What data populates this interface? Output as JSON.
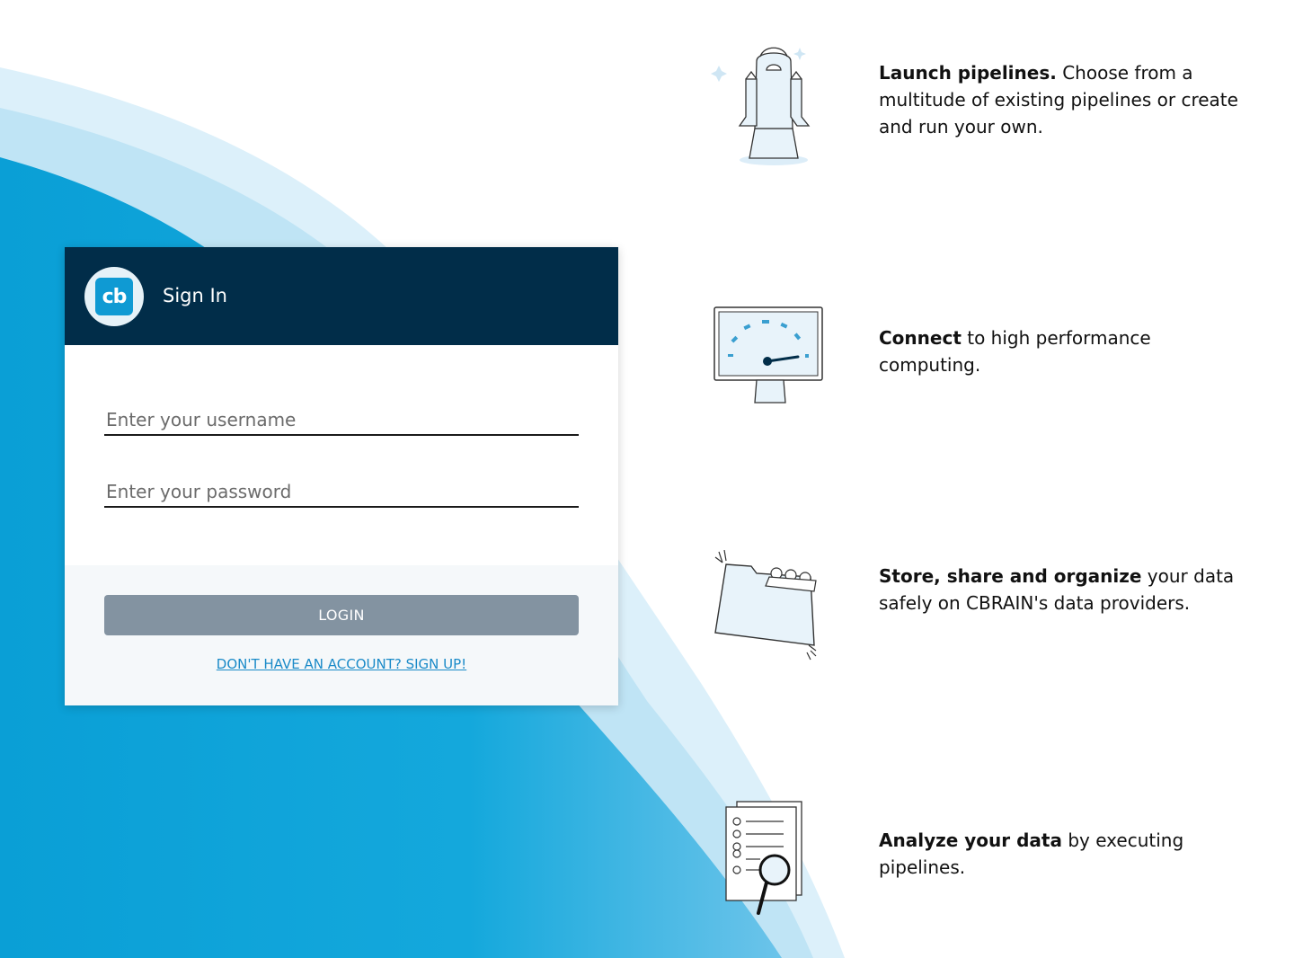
{
  "signin": {
    "logo_text": "cb",
    "title": "Sign In",
    "username_placeholder": "Enter your username",
    "password_placeholder": "Enter your password",
    "login_label": "LOGIN",
    "signup_label": "DON'T HAVE AN ACCOUNT? SIGN UP!"
  },
  "features": [
    {
      "bold": "Launch pipelines.",
      "rest": " Choose from a multitude of existing pipelines or create and run your own.",
      "icon": "rocket-icon"
    },
    {
      "bold": "Connect",
      "rest": " to high performance computing.",
      "icon": "monitor-gauge-icon"
    },
    {
      "bold": "Store, share and organize",
      "rest": " your data safely on CBRAIN's data providers.",
      "icon": "folder-icon"
    },
    {
      "bold": "Analyze your data",
      "rest": " by executing pipelines.",
      "icon": "document-search-icon"
    }
  ],
  "colors": {
    "header": "#012d49",
    "accent": "#0f9ad3",
    "wave": "#0aa3d8",
    "button": "#8393a1",
    "link": "#1a8ac8"
  }
}
